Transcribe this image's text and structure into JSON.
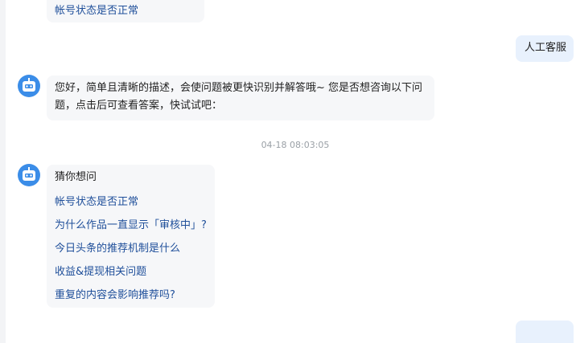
{
  "messages": {
    "top_link": "帐号状态是否正常",
    "user_message": "人工客服",
    "bot_reply": {
      "line1": "您好，简单且清晰的描述，会使问题被更快识别并解答哦~ 您是否想咨询以下问",
      "line2": "题，点击后可查看答案，快试试吧："
    },
    "timestamp": "04-18 08:03:05",
    "suggest": {
      "title": "猜你想问",
      "items": [
        "帐号状态是否正常",
        "为什么作品一直显示「审核中」?",
        "今日头条的推荐机制是什么",
        "收益&提现相关问题",
        "重复的内容会影响推荐吗?"
      ]
    }
  },
  "icons": {
    "bot_avatar": "robot-icon"
  },
  "colors": {
    "avatar": "#3b8de8",
    "link": "#1f4f9a",
    "user_bubble": "#e8f1fd",
    "bot_bubble": "#f6f7f9"
  }
}
